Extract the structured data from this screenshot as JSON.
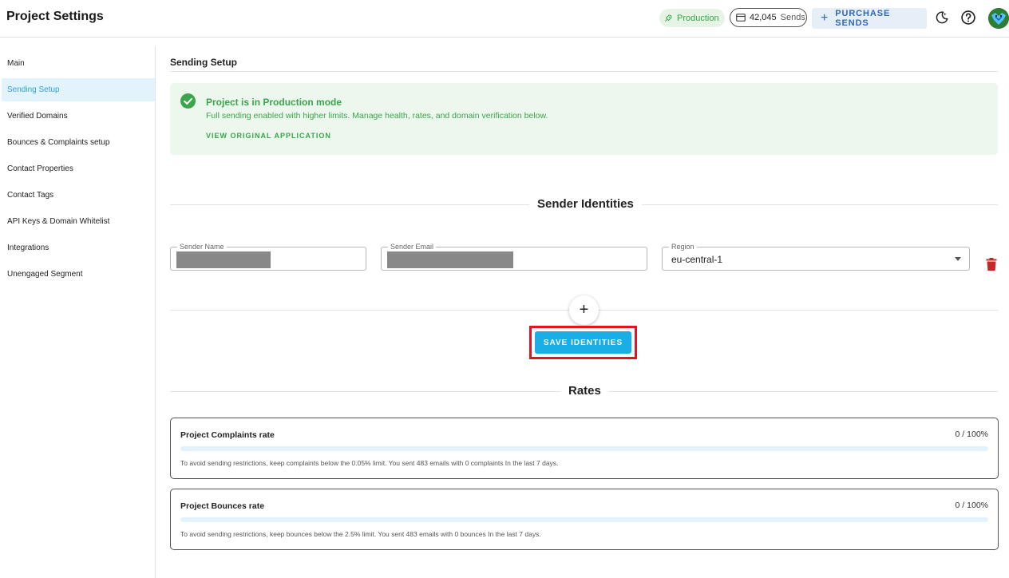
{
  "header": {
    "title": "Project Settings",
    "production_badge": "Production",
    "sends_count": "42,045",
    "sends_label": "Sends",
    "purchase_label": "PURCHASE SENDS"
  },
  "sidebar": {
    "items": [
      {
        "label": "Main",
        "active": false
      },
      {
        "label": "Sending Setup",
        "active": true
      },
      {
        "label": "Verified Domains",
        "active": false
      },
      {
        "label": "Bounces & Complaints setup",
        "active": false
      },
      {
        "label": "Contact Properties",
        "active": false
      },
      {
        "label": "Contact Tags",
        "active": false
      },
      {
        "label": "API Keys & Domain Whitelist",
        "active": false
      },
      {
        "label": "Integrations",
        "active": false
      },
      {
        "label": "Unengaged Segment",
        "active": false
      }
    ]
  },
  "main": {
    "section_title": "Sending Setup",
    "alert": {
      "title": "Project is in Production mode",
      "description": "Full sending enabled with higher limits. Manage health, rates, and domain verification below.",
      "link": "VIEW ORIGINAL APPLICATION"
    },
    "sender_identities": {
      "heading": "Sender Identities",
      "fields": {
        "name_label": "Sender Name",
        "email_label": "Sender Email",
        "region_label": "Region",
        "region_value": "eu-central-1"
      },
      "add_symbol": "+",
      "save_label": "SAVE IDENTITIES"
    },
    "rates": {
      "heading": "Rates",
      "cards": [
        {
          "title": "Project Complaints rate",
          "value": "0 / 100%",
          "fill_fraction": 0,
          "note": "To avoid sending restrictions, keep complaints below the 0.05% limit. You sent 483 emails with 0 complaints In the last 7 days."
        },
        {
          "title": "Project Bounces rate",
          "value": "0 / 100%",
          "fill_fraction": 0,
          "note": "To avoid sending restrictions, keep bounces below the 2.5% limit. You sent 483 emails with 0 bounces In the last 7 days."
        }
      ]
    }
  },
  "colors": {
    "accent": "#1aaee6",
    "success": "#3aa54a",
    "highlight_outline": "#e3141f",
    "danger": "#c62828"
  },
  "icons": [
    "rocket-icon",
    "card-icon",
    "plus-icon",
    "moon-icon",
    "help-icon",
    "avatar",
    "check-circle-icon",
    "caret-down-icon",
    "trash-icon"
  ]
}
